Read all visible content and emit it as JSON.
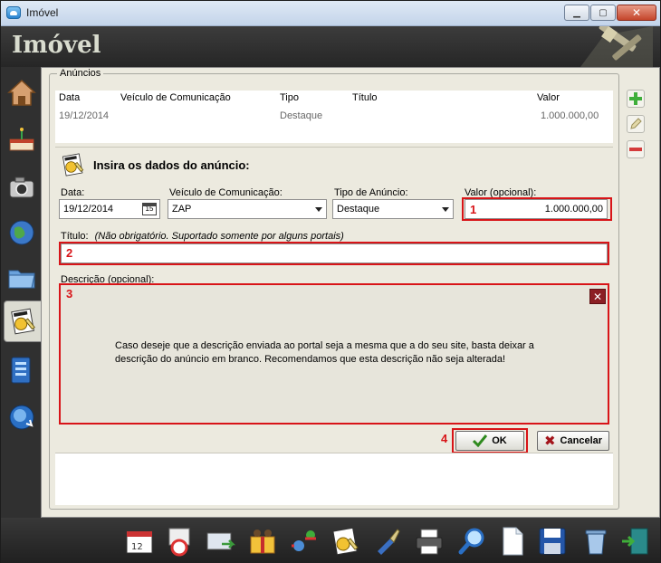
{
  "window": {
    "title": "Imóvel"
  },
  "header": {
    "title": "Imóvel"
  },
  "group": {
    "legend": "Anúncios"
  },
  "grid": {
    "columns": [
      "Data",
      "Veículo de Comunicação",
      "Tipo",
      "Título",
      "Valor"
    ],
    "rows": [
      {
        "data": "19/12/2014",
        "veiculo": "",
        "tipo": "Destaque",
        "titulo": "",
        "valor": "1.000.000,00"
      }
    ]
  },
  "form": {
    "heading": "Insira os dados do anúncio:",
    "data_label": "Data:",
    "data_value": "19/12/2014",
    "calendar_day": "15",
    "veiculo_label": "Veículo de Comunicação:",
    "veiculo_value": "ZAP",
    "tipo_label": "Tipo de Anúncio:",
    "tipo_value": "Destaque",
    "valor_label": "Valor (opcional):",
    "valor_value": "1.000.000,00",
    "titulo_label": "Título:",
    "titulo_hint": "(Não obrigatório. Suportado somente por alguns portais)",
    "titulo_value": "",
    "descricao_label": "Descrição (opcional):",
    "descricao_text": "Caso deseje que a descrição enviada ao portal seja a mesma que a do seu site, basta deixar a descrição do anúncio em branco. Recomendamos que esta descrição não seja alterada!",
    "ok_label": "OK",
    "cancel_label": "Cancelar"
  },
  "highlights": {
    "h1": "1",
    "h2": "2",
    "h3": "3",
    "h4": "4"
  },
  "colors": {
    "highlight": "#d81418",
    "frame_bg": "#eceadf",
    "dark_bg": "#2e2e2e"
  },
  "left_toolbar": [
    "house-icon",
    "cake-icon",
    "camera-icon",
    "globe-icon",
    "folder-icon",
    "certificate-icon",
    "document-blue-icon",
    "refresh-globe-icon"
  ],
  "bottom_toolbar": [
    "calendar-icon",
    "flag-icon",
    "mail-card-icon",
    "people-icon",
    "exchange-icon",
    "certificate-icon",
    "brush-icon",
    "printer-icon",
    "magnifier-icon",
    "blank-page-icon",
    "floppy-icon",
    "trash-icon",
    "exit-door-icon"
  ],
  "side_actions": [
    "add-icon",
    "edit-icon",
    "remove-icon"
  ]
}
